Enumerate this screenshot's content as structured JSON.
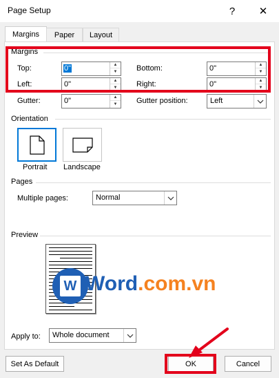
{
  "window": {
    "title": "Page Setup",
    "help": "?",
    "close": "✕"
  },
  "tabs": [
    "Margins",
    "Paper",
    "Layout"
  ],
  "margins": {
    "group_label": "Margins",
    "top_label": "Top:",
    "top_value": "0\"",
    "left_label": "Left:",
    "left_value": "0\"",
    "bottom_label": "Bottom:",
    "bottom_value": "0\"",
    "right_label": "Right:",
    "right_value": "0\"",
    "gutter_label": "Gutter:",
    "gutter_value": "0\"",
    "gutter_position_label": "Gutter position:",
    "gutter_position_value": "Left"
  },
  "orientation": {
    "label": "Orientation",
    "portrait": "Portrait",
    "landscape": "Landscape"
  },
  "pages": {
    "label": "Pages",
    "multiple_label": "Multiple pages:",
    "multiple_value": "Normal"
  },
  "preview": {
    "label": "Preview",
    "watermark_word": "Word",
    "watermark_rest": ".com.vn",
    "logo_letter": "W"
  },
  "apply": {
    "label": "Apply to:",
    "value": "Whole document"
  },
  "buttons": {
    "default": "Set As Default",
    "ok": "OK",
    "cancel": "Cancel"
  },
  "colors": {
    "accent": "#0078d7",
    "highlight_red": "#e3001b",
    "watermark_blue": "#1f5fb4",
    "watermark_orange": "#f58220"
  }
}
